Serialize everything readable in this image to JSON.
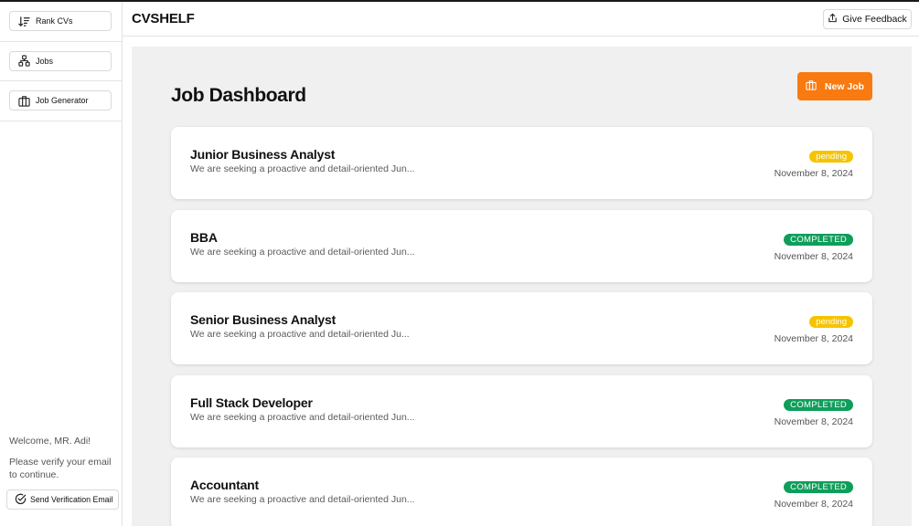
{
  "sidebar": {
    "items": [
      {
        "label": "Rank CVs",
        "icon": "sort-descending-icon"
      },
      {
        "label": "Jobs",
        "icon": "hierarchy-icon"
      },
      {
        "label": "Job Generator",
        "icon": "briefcase-icon"
      }
    ],
    "welcome": "Welcome, MR. Adi!",
    "verify_line1": "Please verify your email",
    "verify_line2": "to continue.",
    "send_verification_label": "Send Verification Email"
  },
  "header": {
    "brand": "CVSHELF",
    "feedback_label": "Give Feedback"
  },
  "main": {
    "title": "Job Dashboard",
    "new_job_label": "New Job",
    "accent_color": "#f97a10",
    "jobs": [
      {
        "title": "Junior Business Analyst",
        "description": "We are seeking a proactive and detail-oriented Jun...",
        "status": "pending",
        "date": "November 8, 2024"
      },
      {
        "title": "BBA",
        "description": "We are seeking a proactive and detail-oriented Jun...",
        "status": "COMPLETED",
        "date": "November 8, 2024"
      },
      {
        "title": "Senior Business Analyst",
        "description": "We are seeking a proactive and detail-oriented Ju...",
        "status": "pending",
        "date": "November 8, 2024"
      },
      {
        "title": "Full Stack Developer",
        "description": "We are seeking a proactive and detail-oriented Jun...",
        "status": "COMPLETED",
        "date": "November 8, 2024"
      },
      {
        "title": "Accountant",
        "description": "We are seeking a proactive and detail-oriented Jun...",
        "status": "COMPLETED",
        "date": "November 8, 2024"
      }
    ]
  }
}
